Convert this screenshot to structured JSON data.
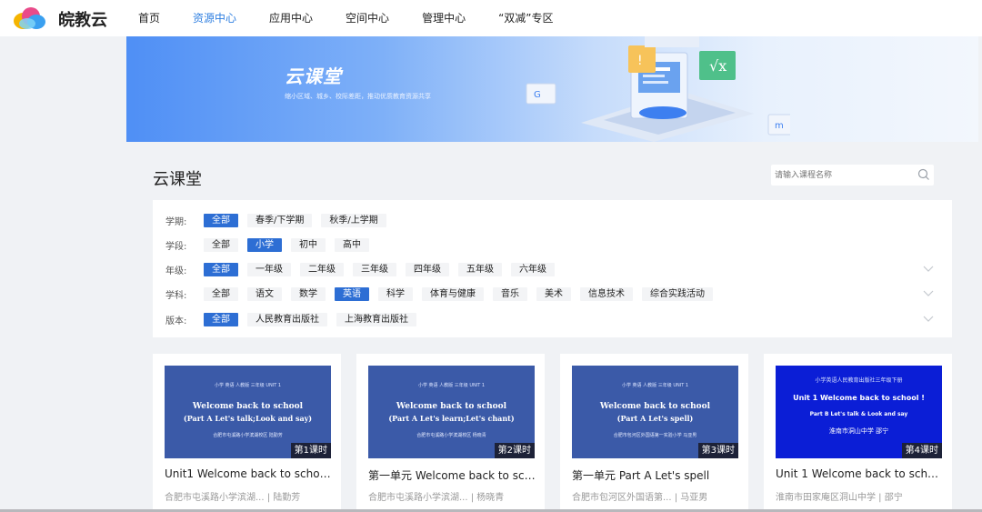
{
  "brand": {
    "name": "皖教云"
  },
  "nav": [
    {
      "label": "首页",
      "active": false
    },
    {
      "label": "资源中心",
      "active": true
    },
    {
      "label": "应用中心",
      "active": false
    },
    {
      "label": "空间中心",
      "active": false
    },
    {
      "label": "管理中心",
      "active": false
    },
    {
      "label": "“双减”专区",
      "active": false
    }
  ],
  "banner": {
    "title": "云课堂",
    "subtitle": "缩小区域、城乡、校际差距，推动优质教育资源共享"
  },
  "section": {
    "title": "云课堂"
  },
  "search": {
    "placeholder": "请输入课程名称",
    "icon": "search-icon"
  },
  "filters": [
    {
      "label": "学期:",
      "options": [
        "全部",
        "春季/下学期",
        "秋季/上学期"
      ],
      "selected": 0,
      "expandable": false
    },
    {
      "label": "学段:",
      "options": [
        "全部",
        "小学",
        "初中",
        "高中"
      ],
      "selected": 1,
      "expandable": false
    },
    {
      "label": "年级:",
      "options": [
        "全部",
        "一年级",
        "二年级",
        "三年级",
        "四年级",
        "五年级",
        "六年级"
      ],
      "selected": 0,
      "expandable": true
    },
    {
      "label": "学科:",
      "options": [
        "全部",
        "语文",
        "数学",
        "英语",
        "科学",
        "体育与健康",
        "音乐",
        "美术",
        "信息技术",
        "综合实践活动"
      ],
      "selected": 3,
      "expandable": true
    },
    {
      "label": "版本:",
      "options": [
        "全部",
        "人民教育出版社",
        "上海教育出版社"
      ],
      "selected": 0,
      "expandable": true
    }
  ],
  "courses": [
    {
      "thumb_header": "小学 英语 人教版 三年级 UNIT 1",
      "thumb_title": "Welcome back to school",
      "thumb_subtitle": "(Part A Let's talk;Look and say)",
      "thumb_footer": "合肥市屯溪路小学滨湖校区 陆勤芳",
      "lesson": "第1课时",
      "title": "Unit1 Welcome back to school...",
      "meta": "合肥市屯溪路小学滨湖...  | 陆勤芳",
      "style": "standard"
    },
    {
      "thumb_header": "小学 英语 人教版 三年级 UNIT 1",
      "thumb_title": "Welcome back to school",
      "thumb_subtitle": "(Part A Let's learn;Let's chant)",
      "thumb_footer": "合肥市屯溪路小学滨湖校区 杨晓青",
      "lesson": "第2课时",
      "title": "第一单元 Welcome back to sch...",
      "meta": "合肥市屯溪路小学滨湖...  | 杨晓青",
      "style": "standard"
    },
    {
      "thumb_header": "小学 英语 人教版 三年级 UNIT 1",
      "thumb_title": "Welcome back to school",
      "thumb_subtitle": "(Part A Let's spell)",
      "thumb_footer": "合肥市包河区外国语第一实验小学 马亚男",
      "lesson": "第3课时",
      "title": "第一单元 Part A Let's spell",
      "meta": "合肥市包河区外国语第...  | 马亚男",
      "style": "standard"
    },
    {
      "thumb_header": "小学英语人民教育出版社三年级下册",
      "thumb_title": "Unit 1  Welcome back to school !",
      "thumb_subtitle": "Part B Let's talk &  Look and say",
      "thumb_footer": "淮南市洞山中学  邵宁",
      "lesson": "第4课时",
      "title": "Unit 1 Welcome back to schoo...",
      "meta": "淮南市田家庵区洞山中学 | 邵宁",
      "style": "blue"
    }
  ],
  "colors": {
    "accent": "#2d6ed4",
    "nav_active": "#2f7fe0",
    "thumb": "#3b5aa8",
    "thumb_alt": "#0b1ed6"
  }
}
